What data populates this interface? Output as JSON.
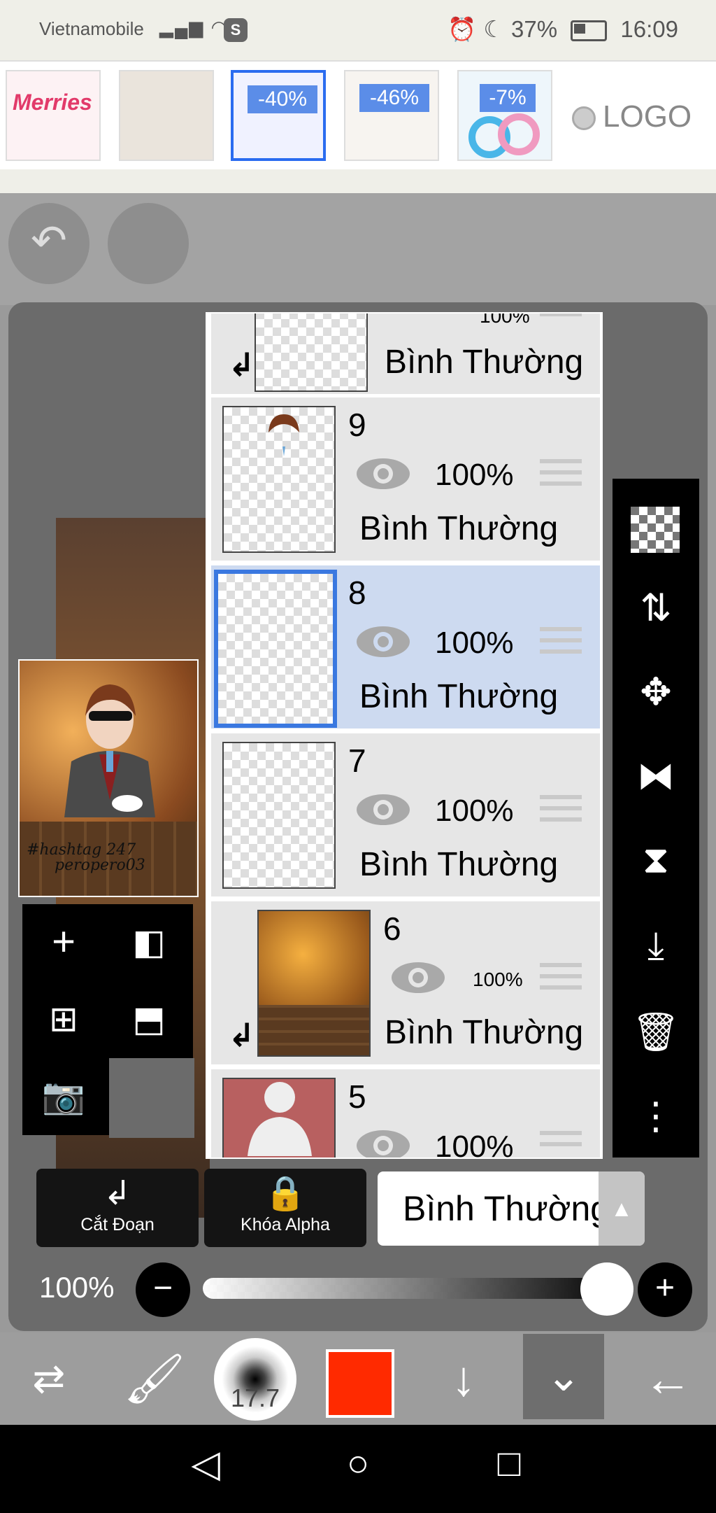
{
  "status_bar": {
    "carrier": "Vietnamobile",
    "signal_icons": "▂▄▆ ◠",
    "badge": "S",
    "battery": "37%",
    "time": "16:09"
  },
  "ad": {
    "thumbs": [
      {
        "brand": "Merries",
        "discount": ""
      },
      {
        "brand": "",
        "discount": ""
      },
      {
        "brand": "",
        "discount": "-40%"
      },
      {
        "brand": "",
        "discount": "-46%"
      },
      {
        "brand": "",
        "discount": "-7%"
      }
    ],
    "logo": "LOGO"
  },
  "preview": {
    "signature_line1": "#hashtag 247",
    "signature_line2": "peropero03"
  },
  "layers": [
    {
      "number": "",
      "opacity": "100%",
      "mode": "Bình Thường",
      "clipped": true
    },
    {
      "number": "9",
      "opacity": "100%",
      "mode": "Bình Thường",
      "clipped": false
    },
    {
      "number": "8",
      "opacity": "100%",
      "mode": "Bình Thường",
      "clipped": false,
      "selected": true
    },
    {
      "number": "7",
      "opacity": "100%",
      "mode": "Bình Thường",
      "clipped": false
    },
    {
      "number": "6",
      "opacity": "100%",
      "mode": "Bình Thường",
      "clipped": true
    },
    {
      "number": "5",
      "opacity": "100%",
      "mode": "",
      "clipped": false
    }
  ],
  "options": {
    "clipping_label": "Cắt Đoạn",
    "alpha_lock_label": "Khóa Alpha",
    "blend_mode": "Bình Thường",
    "opacity": "100%"
  },
  "brush": {
    "size": "17.7",
    "color": "#ff2a00"
  }
}
